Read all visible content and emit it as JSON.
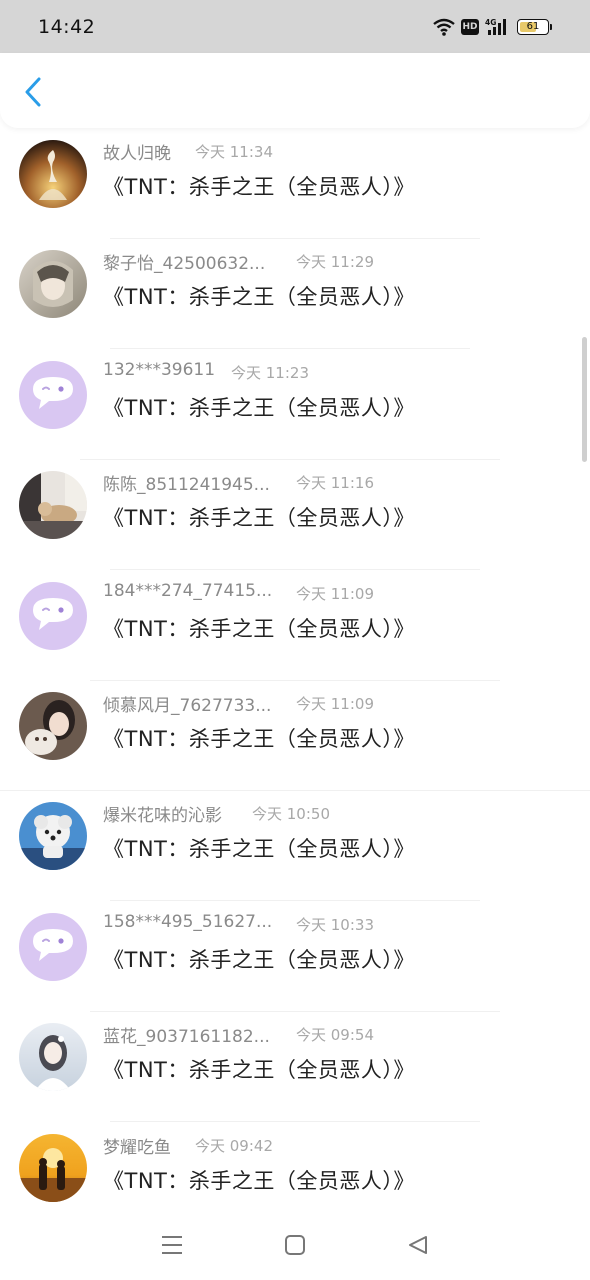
{
  "status_bar": {
    "time": "14:42",
    "network": "4G",
    "hd": "HD",
    "battery": "61",
    "battery_level": 0.61,
    "icons": [
      "wifi-icon",
      "hd-icon",
      "signal-4g-icon",
      "battery-icon"
    ]
  },
  "header": {
    "back_icon": "chevron-left-icon",
    "accent_color": "#2a9de8"
  },
  "colors": {
    "placeholder_avatar_bg": "#d9c7f2",
    "name": "#8a8a8a",
    "time": "#a8a8a8",
    "message": "#222222"
  },
  "list": {
    "items": [
      {
        "name": "故人归晚",
        "time": "今天 11:34",
        "message": "《TNT：杀手之王（全员恶人）》",
        "avatar": "photo-dancer"
      },
      {
        "name": "黎子怡_42500632...",
        "time": "今天 11:29",
        "message": "《TNT：杀手之王（全员恶人）》",
        "avatar": "photo-anime"
      },
      {
        "name": "132***39611",
        "time": "今天 11:23",
        "message": "《TNT：杀手之王（全员恶人）》",
        "avatar": "default-chat-bubble"
      },
      {
        "name": "陈陈_8511241945...",
        "time": "今天 11:16",
        "message": "《TNT：杀手之王（全员恶人）》",
        "avatar": "photo-cat-room"
      },
      {
        "name": "184***274_77415...",
        "time": "今天 11:09",
        "message": "《TNT：杀手之王（全员恶人）》",
        "avatar": "default-chat-bubble"
      },
      {
        "name": "倾慕风月_7627733...",
        "time": "今天 11:09",
        "message": "《TNT：杀手之王（全员恶人）》",
        "avatar": "photo-girl-cat"
      },
      {
        "name": "爆米花味的沁影",
        "time": "今天 10:50",
        "message": "《TNT：杀手之王（全员恶人）》",
        "avatar": "photo-dog"
      },
      {
        "name": "158***495_51627...",
        "time": "今天 10:33",
        "message": "《TNT：杀手之王（全员恶人）》",
        "avatar": "default-chat-bubble"
      },
      {
        "name": "蓝花_9037161182...",
        "time": "今天 09:54",
        "message": "《TNT：杀手之王（全员恶人）》",
        "avatar": "photo-girl-white"
      },
      {
        "name": "梦耀吃鱼",
        "time": "今天 09:42",
        "message": "《TNT：杀手之王（全员恶人）》",
        "avatar": "photo-sunset-couple"
      }
    ]
  },
  "nav_bar": {
    "icons": [
      "menu-icon",
      "home-square-icon",
      "back-triangle-icon"
    ]
  }
}
